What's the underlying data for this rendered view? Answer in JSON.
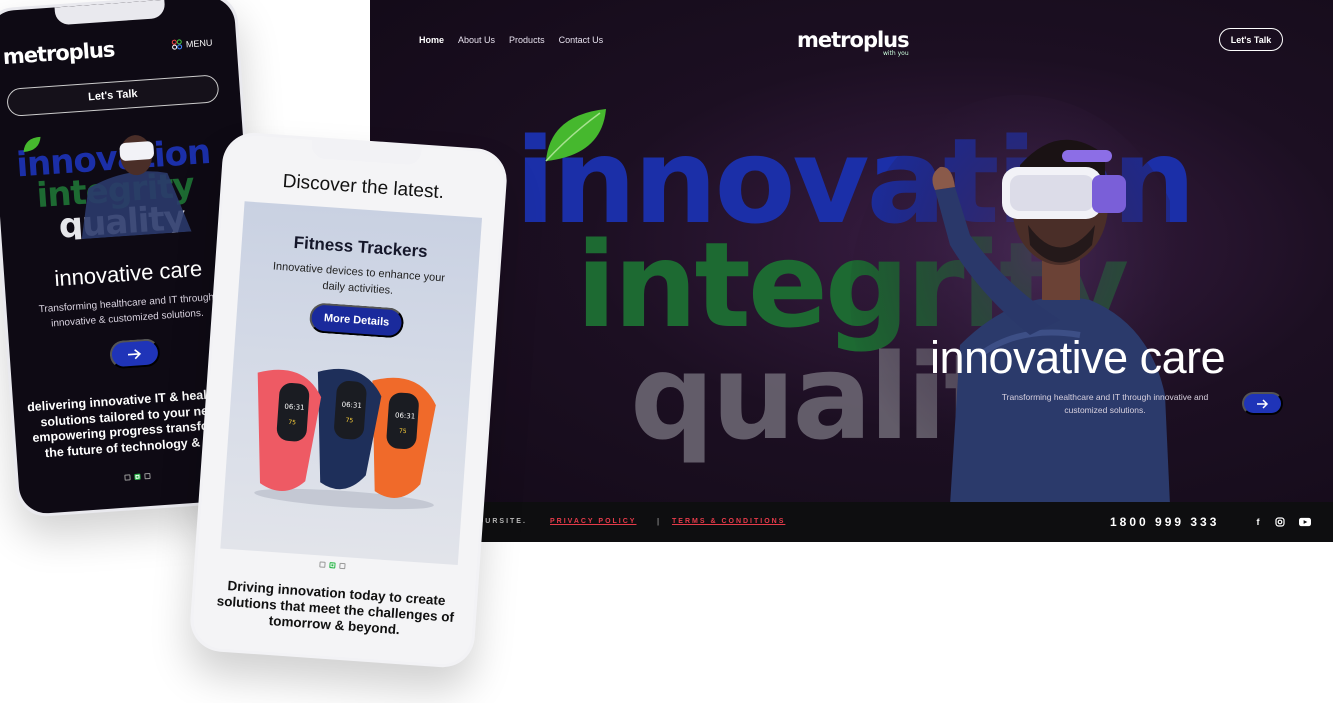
{
  "brand": {
    "name": "metroplus",
    "tagline": "with you"
  },
  "desktop": {
    "nav": [
      "Home",
      "About Us",
      "Products",
      "Contact Us"
    ],
    "cta": "Let's Talk",
    "hero_words": [
      "innovation",
      "integrity",
      "quality"
    ],
    "headline": "innovative care",
    "subtext": "Transforming healthcare and IT through innovative and customized solutions.",
    "arrow_icon": "arrow-right-icon",
    "footer": {
      "copyright": "T © YOURSITE.",
      "privacy": "PRIVACY POLICY",
      "separator": "|",
      "terms": "TERMS & CONDITIONS",
      "phone": "1800 999 333",
      "social": [
        "facebook-icon",
        "instagram-icon",
        "youtube-icon"
      ]
    }
  },
  "mobile1": {
    "menu_label": "MENU",
    "cta": "Let's Talk",
    "headline": "innovative care",
    "subtext": "Transforming healthcare and IT through innovative & customized solutions.",
    "body": "delivering innovative IT & healthcare solutions tailored to your needs. empowering progress transforming the future of technology & care."
  },
  "mobile2": {
    "title": "Discover the latest.",
    "card_title": "Fitness Trackers",
    "card_sub": "Innovative devices to enhance your daily activities.",
    "card_button": "More Details",
    "watch_time": "06:31",
    "watch_reading": "75",
    "body": "Driving innovation today to create solutions that meet the challenges of tomorrow & beyond."
  },
  "colors": {
    "accent_blue": "#1f34b8",
    "innovation_blue": "#1b2fa8",
    "integrity_green": "#1d6a32",
    "footer_red": "#e63b4a",
    "dark_bg": "#120a17"
  }
}
